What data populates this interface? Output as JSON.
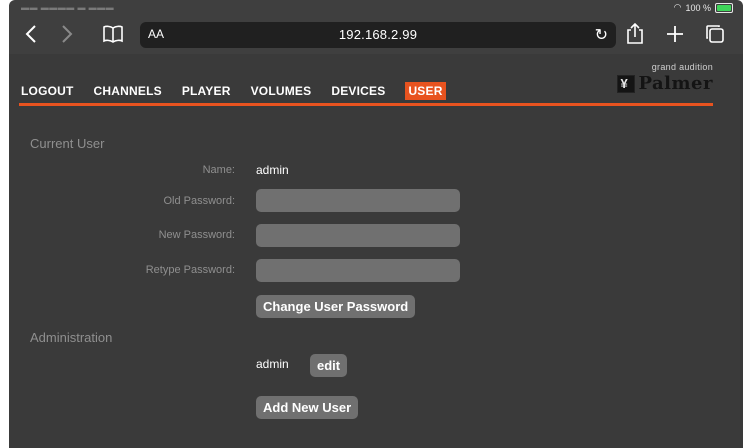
{
  "browser": {
    "status": {
      "battery": "100 %"
    },
    "url_aa": "AA",
    "url": "192.168.2.99"
  },
  "menu": {
    "items": [
      {
        "label": "LOGOUT",
        "active": false
      },
      {
        "label": "CHANNELS",
        "active": false
      },
      {
        "label": "PLAYER",
        "active": false
      },
      {
        "label": "VOLUMES",
        "active": false
      },
      {
        "label": "DEVICES",
        "active": false
      },
      {
        "label": "USER",
        "active": true
      }
    ]
  },
  "logo": {
    "tagline": "grand audition",
    "name": "Palmer"
  },
  "current_user": {
    "title": "Current User",
    "name_label": "Name:",
    "name_value": "admin",
    "old_password_label": "Old Password:",
    "new_password_label": "New Password:",
    "retype_password_label": "Retype Password:",
    "change_button": "Change User Password"
  },
  "administration": {
    "title": "Administration",
    "user": "admin",
    "edit_button": "edit",
    "add_button": "Add New User"
  },
  "colors": {
    "accent": "#e8531f",
    "background": "#3a3a3a",
    "field": "#707070"
  }
}
